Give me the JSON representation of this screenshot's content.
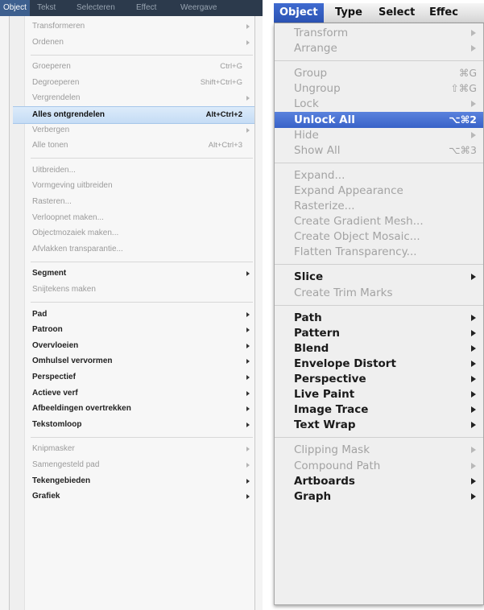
{
  "left_menu": {
    "menubar": [
      {
        "label": "Object",
        "active": true
      },
      {
        "label": "Tekst",
        "active": false
      },
      {
        "label": "Selecteren",
        "active": false
      },
      {
        "label": "Effect",
        "active": false
      },
      {
        "label": "Weergave",
        "active": false
      }
    ],
    "items": [
      {
        "label": "Transformeren",
        "submenu": true,
        "disabled": true
      },
      {
        "label": "Ordenen",
        "submenu": true,
        "disabled": true
      },
      {
        "separator": true
      },
      {
        "label": "Groeperen",
        "shortcut": "Ctrl+G",
        "disabled": true
      },
      {
        "label": "Degroeperen",
        "shortcut": "Shift+Ctrl+G",
        "disabled": true
      },
      {
        "label": "Vergrendelen",
        "submenu": true,
        "disabled": true
      },
      {
        "label": "Alles ontgrendelen",
        "shortcut": "Alt+Ctrl+2",
        "highlighted": true
      },
      {
        "label": "Verbergen",
        "submenu": true,
        "disabled": true
      },
      {
        "label": "Alle tonen",
        "shortcut": "Alt+Ctrl+3",
        "disabled": true
      },
      {
        "separator": true
      },
      {
        "label": "Uitbreiden...",
        "disabled": true
      },
      {
        "label": "Vormgeving uitbreiden",
        "disabled": true
      },
      {
        "label": "Rasteren...",
        "disabled": true
      },
      {
        "label": "Verloopnet maken...",
        "disabled": true
      },
      {
        "label": "Objectmozaiek maken...",
        "disabled": true
      },
      {
        "label": "Afvlakken transparantie...",
        "disabled": true
      },
      {
        "separator": true
      },
      {
        "label": "Segment",
        "submenu": true,
        "bold": true
      },
      {
        "label": "Snijtekens maken",
        "disabled": true
      },
      {
        "separator": true
      },
      {
        "label": "Pad",
        "submenu": true,
        "bold": true
      },
      {
        "label": "Patroon",
        "submenu": true,
        "bold": true
      },
      {
        "label": "Overvloeien",
        "submenu": true,
        "bold": true
      },
      {
        "label": "Omhulsel vervormen",
        "submenu": true,
        "bold": true
      },
      {
        "label": "Perspectief",
        "submenu": true,
        "bold": true
      },
      {
        "label": "Actieve verf",
        "submenu": true,
        "bold": true
      },
      {
        "label": "Afbeeldingen overtrekken",
        "submenu": true,
        "bold": true
      },
      {
        "label": "Tekstomloop",
        "submenu": true,
        "bold": true
      },
      {
        "separator": true
      },
      {
        "label": "Knipmasker",
        "submenu": true,
        "disabled": true
      },
      {
        "label": "Samengesteld pad",
        "submenu": true,
        "disabled": true
      },
      {
        "label": "Tekengebieden",
        "submenu": true,
        "bold": true
      },
      {
        "label": "Grafiek",
        "submenu": true,
        "bold": true
      }
    ]
  },
  "right_menu": {
    "menubar": [
      {
        "label": "Object",
        "active": true
      },
      {
        "label": "Type",
        "active": false
      },
      {
        "label": "Select",
        "active": false
      },
      {
        "label": "Effec",
        "active": false
      }
    ],
    "items": [
      {
        "label": "Transform",
        "submenu": true,
        "disabled": true
      },
      {
        "label": "Arrange",
        "submenu": true,
        "disabled": true
      },
      {
        "separator": true
      },
      {
        "label": "Group",
        "shortcut": "⌘G",
        "disabled": true
      },
      {
        "label": "Ungroup",
        "shortcut": "⇧⌘G",
        "disabled": true
      },
      {
        "label": "Lock",
        "submenu": true,
        "disabled": true
      },
      {
        "label": "Unlock All",
        "shortcut": "⌥⌘2",
        "highlighted": true
      },
      {
        "label": "Hide",
        "submenu": true,
        "disabled": true
      },
      {
        "label": "Show All",
        "shortcut": "⌥⌘3",
        "disabled": true
      },
      {
        "separator": true
      },
      {
        "label": "Expand...",
        "disabled": true
      },
      {
        "label": "Expand Appearance",
        "disabled": true
      },
      {
        "label": "Rasterize...",
        "disabled": true
      },
      {
        "label": "Create Gradient Mesh...",
        "disabled": true
      },
      {
        "label": "Create Object Mosaic...",
        "disabled": true
      },
      {
        "label": "Flatten Transparency...",
        "disabled": true
      },
      {
        "separator": true
      },
      {
        "label": "Slice",
        "submenu": true,
        "bold": true
      },
      {
        "label": "Create Trim Marks",
        "disabled": true
      },
      {
        "separator": true
      },
      {
        "label": "Path",
        "submenu": true,
        "bold": true
      },
      {
        "label": "Pattern",
        "submenu": true,
        "bold": true
      },
      {
        "label": "Blend",
        "submenu": true,
        "bold": true
      },
      {
        "label": "Envelope Distort",
        "submenu": true,
        "bold": true
      },
      {
        "label": "Perspective",
        "submenu": true,
        "bold": true
      },
      {
        "label": "Live Paint",
        "submenu": true,
        "bold": true
      },
      {
        "label": "Image Trace",
        "submenu": true,
        "bold": true
      },
      {
        "label": "Text Wrap",
        "submenu": true,
        "bold": true
      },
      {
        "separator": true
      },
      {
        "label": "Clipping Mask",
        "submenu": true,
        "disabled": true
      },
      {
        "label": "Compound Path",
        "submenu": true,
        "disabled": true
      },
      {
        "label": "Artboards",
        "submenu": true,
        "bold": true
      },
      {
        "label": "Graph",
        "submenu": true,
        "bold": true
      }
    ]
  },
  "colors": {
    "win_menubar": "#2c3a4c",
    "win_highlight": "#cfe2f7",
    "mac_highlight": "#3862c8"
  }
}
